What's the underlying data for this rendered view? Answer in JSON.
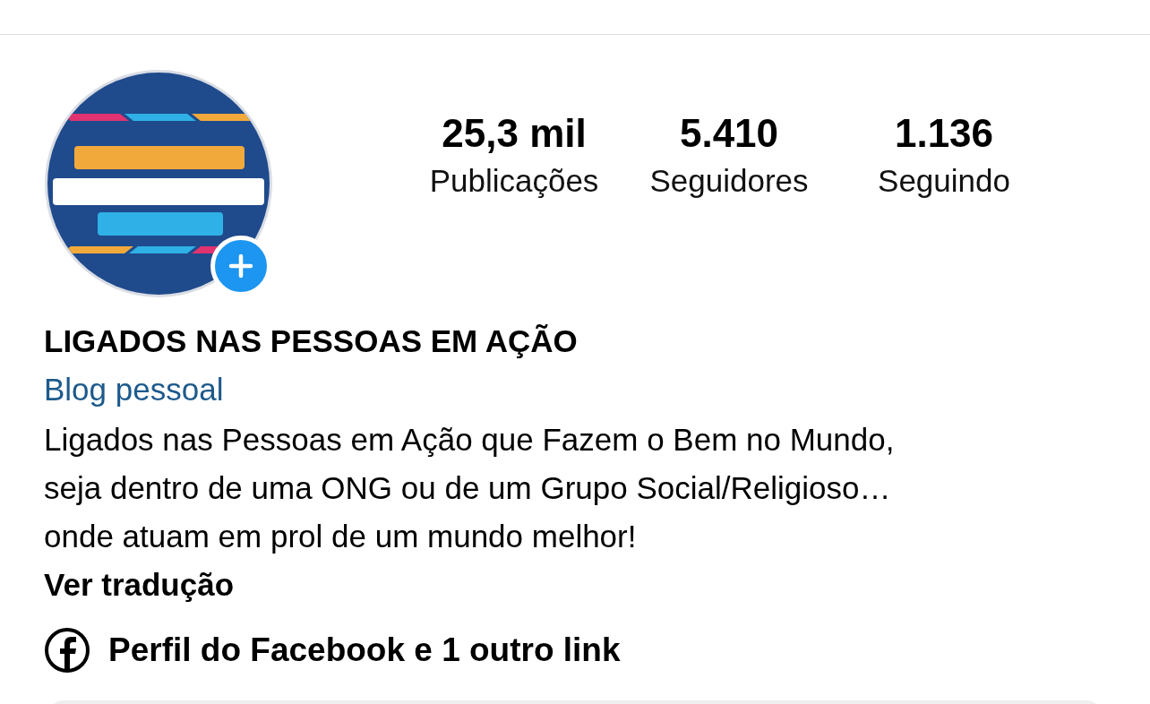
{
  "profile": {
    "stats": [
      {
        "value": "25,3 mil",
        "label": "Publicações"
      },
      {
        "value": "5.410",
        "label": "Seguidores"
      },
      {
        "value": "1.136",
        "label": "Seguindo"
      }
    ],
    "name": "LIGADOS NAS PESSOAS EM AÇÃO",
    "category": "Blog pessoal",
    "bio": [
      "Ligados nas Pessoas em Ação que Fazem o Bem no Mundo,",
      "seja dentro de uma ONG ou de um Grupo Social/Religioso…",
      "onde atuam em prol de um mundo melhor!"
    ],
    "translate": "Ver tradução",
    "link": "Perfil do Facebook e 1 outro link"
  }
}
